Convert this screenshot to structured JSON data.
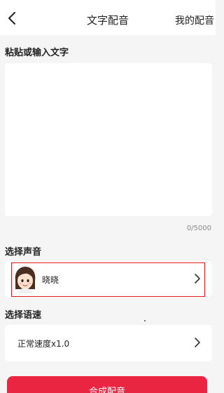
{
  "header": {
    "title": "文字配音",
    "right_label": "我的配音",
    "back_icon": "chevron-left-icon"
  },
  "text_section": {
    "title": "粘贴或输入文字",
    "value": "",
    "placeholder": "",
    "char_count": "0/5000"
  },
  "voice_section": {
    "title": "选择声音",
    "selected_voice": "晓晓",
    "avatar_icon": "girl-avatar",
    "chevron_icon": "chevron-right-icon"
  },
  "speed_section": {
    "title": "选择语速",
    "selected_speed": "正常速度x1.0",
    "chevron_icon": "chevron-right-icon"
  },
  "submit": {
    "label": "合成配音"
  },
  "colors": {
    "accent": "#e92541",
    "highlight": "#e3171d",
    "background": "#f5f5f5"
  }
}
